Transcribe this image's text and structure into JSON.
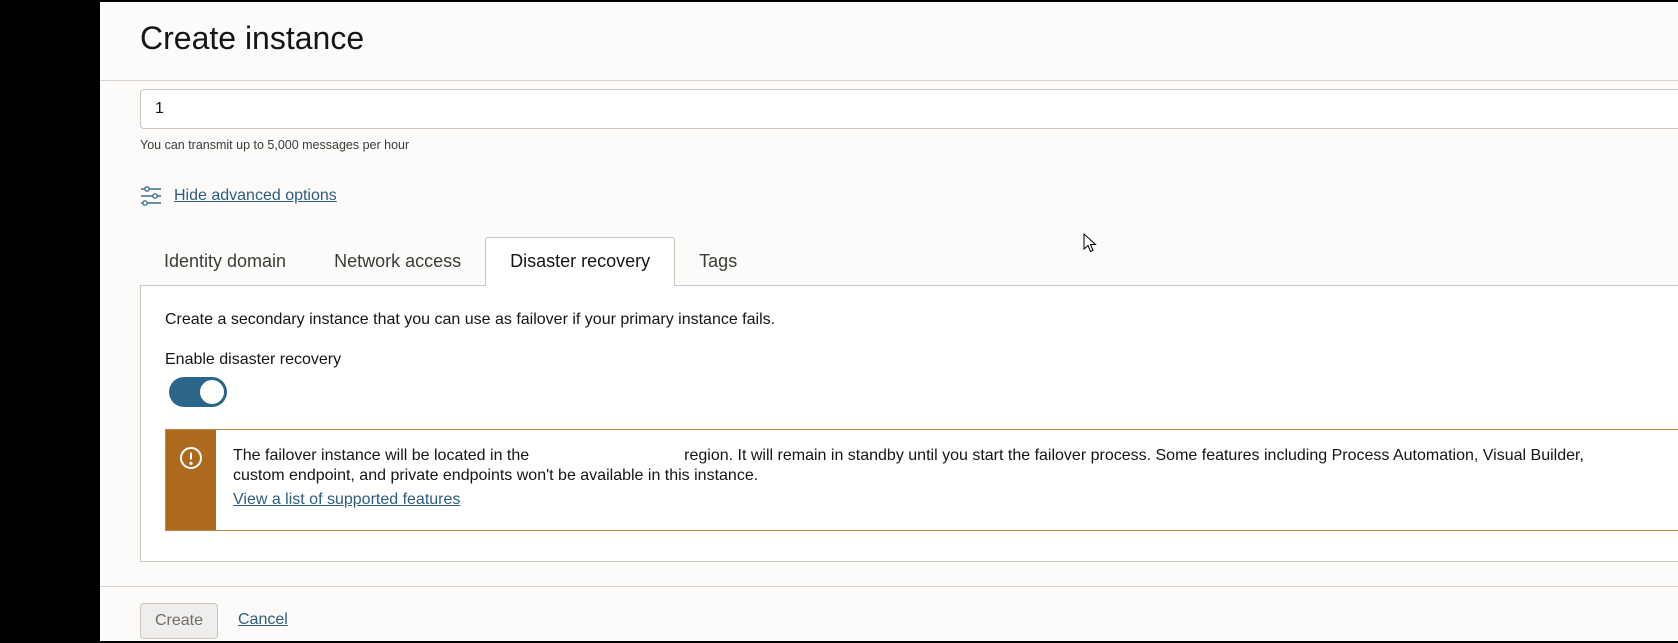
{
  "header": {
    "title": "Create instance"
  },
  "message_count": {
    "value": "1",
    "helper": "You can transmit up to 5,000 messages per hour"
  },
  "advanced": {
    "link_label": "Hide advanced options",
    "icon": "sliders-icon"
  },
  "tabs": [
    {
      "label": "Identity domain",
      "active": false
    },
    {
      "label": "Network access",
      "active": false
    },
    {
      "label": "Disaster recovery",
      "active": true
    },
    {
      "label": "Tags",
      "active": false
    }
  ],
  "disaster_recovery": {
    "description": "Create a secondary instance that you can use as failover if your primary instance fails.",
    "toggle_label": "Enable disaster recovery",
    "toggle_on": true,
    "alert": {
      "icon": "warning-icon",
      "text_before_region": "The failover instance will be located in the",
      "text_after_region": "region. It will remain in standby until you start the failover process. Some features including Process Automation, Visual Builder,",
      "text_line2": "custom endpoint, and private endpoints won't be available in this instance.",
      "link": "View a list of supported features"
    }
  },
  "footer": {
    "create_label": "Create",
    "cancel_label": "Cancel"
  },
  "colors": {
    "accent": "#2b6688",
    "warning": "#ad6a1f",
    "link": "#2c5d7f"
  }
}
